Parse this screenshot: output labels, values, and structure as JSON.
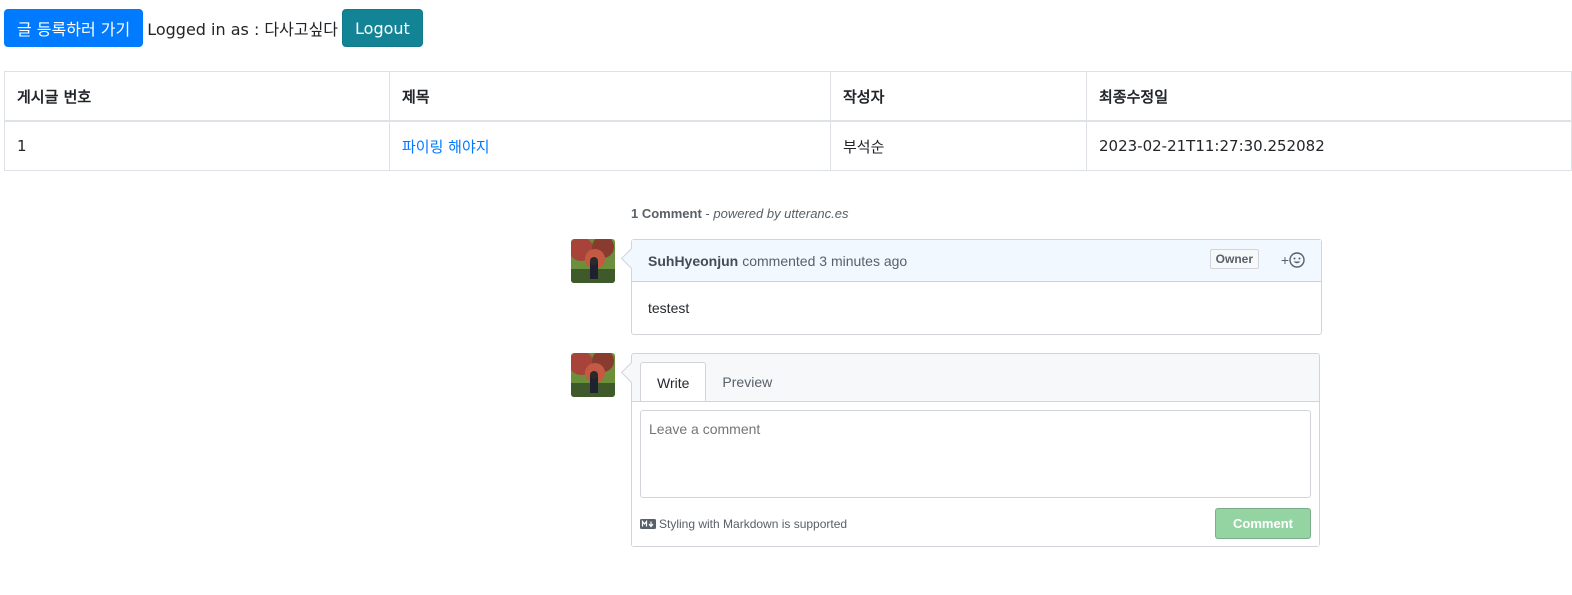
{
  "topbar": {
    "write_button": "글 등록하러 가기",
    "login_text": "Logged in as : 다사고싶다",
    "logout_button": "Logout"
  },
  "table": {
    "headers": [
      "게시글 번호",
      "제목",
      "작성자",
      "최종수정일"
    ],
    "rows": [
      {
        "id": "1",
        "title": "파이링 해야지",
        "author": "부석순",
        "modified": "2023-02-21T11:27:30.252082"
      }
    ]
  },
  "comments": {
    "count_label": "1 Comment",
    "powered_by": "powered by utteranc.es",
    "items": [
      {
        "author": "SuhHyeonjun",
        "action": "commented 3 minutes ago",
        "badge": "Owner",
        "body": "testest"
      }
    ],
    "new_comment": {
      "tab_write": "Write",
      "tab_preview": "Preview",
      "placeholder": "Leave a comment",
      "markdown_note": "Styling with Markdown is supported",
      "submit_label": "Comment"
    }
  },
  "colors": {
    "primary": "#007bff",
    "info": "#138496",
    "link": "#007bff",
    "submit_disabled": "#94d3a2"
  }
}
